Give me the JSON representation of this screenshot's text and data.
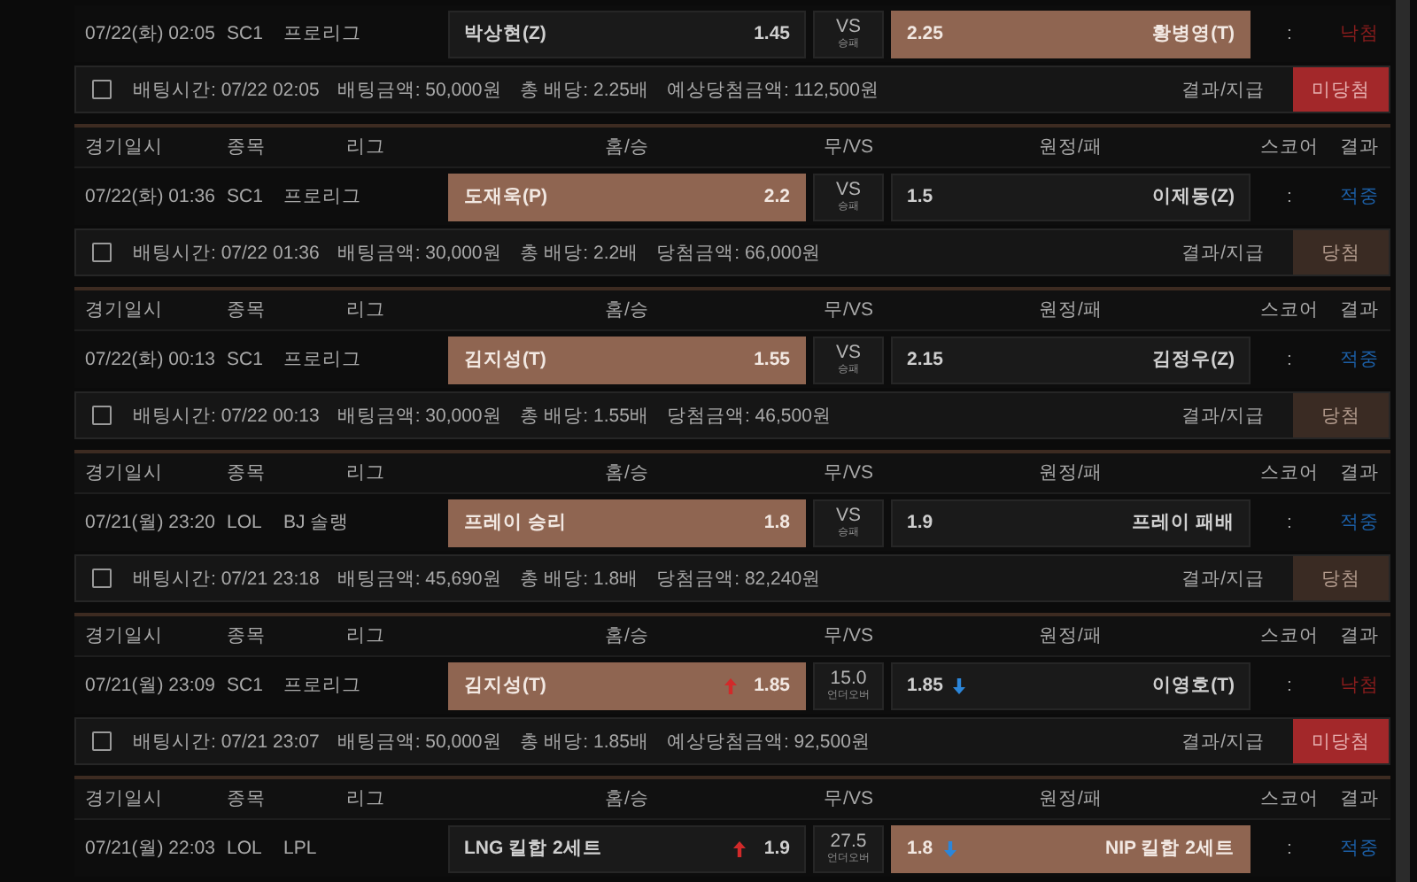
{
  "bets": [
    {
      "date": "07/22(화) 02:05",
      "sport": "SC1",
      "league": "프로리그",
      "home": {
        "name": "박상현(Z)",
        "odds": "1.45",
        "selected": false
      },
      "draw": {
        "main": "VS",
        "sub": "승패"
      },
      "away": {
        "odds": "2.25",
        "name": "황병영(T)",
        "selected": true
      },
      "score": ":",
      "result": {
        "kind": "miss",
        "label": "낙첨"
      },
      "checked": false,
      "info": [
        "배팅시간: 07/22 02:05",
        "배팅금액: 50,000원",
        "총 배당: 2.25배",
        "예상당첨금액: 112,500원"
      ],
      "payout_label": "결과/지급",
      "status": {
        "kind": "lost",
        "label": "미당첨"
      }
    },
    {
      "columns": [
        "경기일시",
        "종목",
        "리그",
        "홈/승",
        "무/VS",
        "원정/패",
        "스코어",
        "결과"
      ],
      "date": "07/22(화) 01:36",
      "sport": "SC1",
      "league": "프로리그",
      "home": {
        "name": "도재욱(P)",
        "odds": "2.2",
        "selected": true
      },
      "draw": {
        "main": "VS",
        "sub": "승패"
      },
      "away": {
        "odds": "1.5",
        "name": "이제동(Z)",
        "selected": false
      },
      "score": ":",
      "result": {
        "kind": "hit",
        "label": "적중"
      },
      "checked": false,
      "info": [
        "배팅시간: 07/22 01:36",
        "배팅금액: 30,000원",
        "총 배당: 2.2배",
        "당첨금액: 66,000원"
      ],
      "payout_label": "결과/지급",
      "status": {
        "kind": "won",
        "label": "당첨"
      }
    },
    {
      "columns": [
        "경기일시",
        "종목",
        "리그",
        "홈/승",
        "무/VS",
        "원정/패",
        "스코어",
        "결과"
      ],
      "date": "07/22(화) 00:13",
      "sport": "SC1",
      "league": "프로리그",
      "home": {
        "name": "김지성(T)",
        "odds": "1.55",
        "selected": true
      },
      "draw": {
        "main": "VS",
        "sub": "승패"
      },
      "away": {
        "odds": "2.15",
        "name": "김정우(Z)",
        "selected": false
      },
      "score": ":",
      "result": {
        "kind": "hit",
        "label": "적중"
      },
      "checked": false,
      "info": [
        "배팅시간: 07/22 00:13",
        "배팅금액: 30,000원",
        "총 배당: 1.55배",
        "당첨금액: 46,500원"
      ],
      "payout_label": "결과/지급",
      "status": {
        "kind": "won",
        "label": "당첨"
      }
    },
    {
      "columns": [
        "경기일시",
        "종목",
        "리그",
        "홈/승",
        "무/VS",
        "원정/패",
        "스코어",
        "결과"
      ],
      "date": "07/21(월) 23:20",
      "sport": "LOL",
      "league": "BJ 솔랭",
      "home": {
        "name": "프레이 승리",
        "odds": "1.8",
        "selected": true
      },
      "draw": {
        "main": "VS",
        "sub": "승패"
      },
      "away": {
        "odds": "1.9",
        "name": "프레이 패배",
        "selected": false
      },
      "score": ":",
      "result": {
        "kind": "hit",
        "label": "적중"
      },
      "checked": false,
      "info": [
        "배팅시간: 07/21 23:18",
        "배팅금액: 45,690원",
        "총 배당: 1.8배",
        "당첨금액: 82,240원"
      ],
      "payout_label": "결과/지급",
      "status": {
        "kind": "won",
        "label": "당첨"
      }
    },
    {
      "columns": [
        "경기일시",
        "종목",
        "리그",
        "홈/승",
        "무/VS",
        "원정/패",
        "스코어",
        "결과"
      ],
      "date": "07/21(월) 23:09",
      "sport": "SC1",
      "league": "프로리그",
      "home": {
        "name": "김지성(T)",
        "odds": "1.85",
        "selected": true,
        "rising": true
      },
      "draw": {
        "main": "15.0",
        "sub": "언더오버"
      },
      "away": {
        "odds": "1.85",
        "name": "이영호(T)",
        "selected": false,
        "falling": true
      },
      "score": ":",
      "result": {
        "kind": "miss",
        "label": "낙첨"
      },
      "checked": false,
      "info": [
        "배팅시간: 07/21 23:07",
        "배팅금액: 50,000원",
        "총 배당: 1.85배",
        "예상당첨금액: 92,500원"
      ],
      "payout_label": "결과/지급",
      "status": {
        "kind": "lost",
        "label": "미당첨"
      }
    },
    {
      "columns": [
        "경기일시",
        "종목",
        "리그",
        "홈/승",
        "무/VS",
        "원정/패",
        "스코어",
        "결과"
      ],
      "date": "07/21(월) 22:03",
      "sport": "LOL",
      "league": "LPL",
      "home": {
        "name": "LNG 킬합 2세트",
        "odds": "1.9",
        "selected": false,
        "rising": true
      },
      "draw": {
        "main": "27.5",
        "sub": "언더오버"
      },
      "away": {
        "odds": "1.8",
        "name": "NIP 킬합 2세트",
        "selected": true,
        "falling": true
      },
      "score": ":",
      "result": {
        "kind": "hit",
        "label": "적중"
      }
    }
  ]
}
